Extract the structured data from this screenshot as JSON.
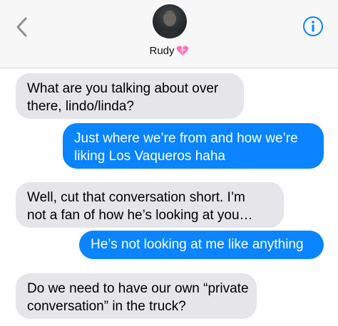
{
  "header": {
    "contact_name": "Rudy",
    "icons": {
      "back": "chevron-left-icon",
      "info": "info-icon",
      "emoji": "heart-with-ribbon-icon"
    },
    "accent_color": "#0a84ff"
  },
  "messages": [
    {
      "from": "received",
      "line1": "What are you talking about over",
      "line2": "there, lindo/linda?"
    },
    {
      "from": "sent",
      "line1": "Just where we’re from and how we’re",
      "line2": "liking Los Vaqueros haha"
    },
    {
      "from": "received",
      "line1": "Well, cut that conversation short. I’m",
      "line2": "not a fan of how he’s looking at you…"
    },
    {
      "from": "sent",
      "line1": "He’s not looking at me like anything"
    },
    {
      "from": "received",
      "line1": "Do we need to have our own “private",
      "line2": "conversation” in the truck?"
    }
  ],
  "colors": {
    "received_bubble": "#e5e5ea",
    "sent_bubble": "#0a84ff"
  }
}
